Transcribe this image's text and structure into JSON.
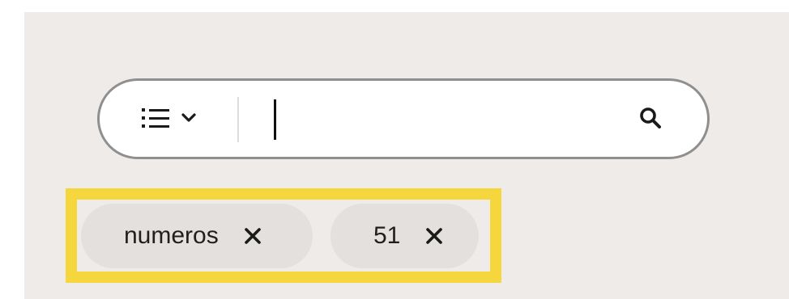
{
  "search": {
    "placeholder": "",
    "value": "",
    "filter_icon": "list-icon",
    "dropdown_icon": "chevron-down-icon",
    "search_icon": "magnifier-icon"
  },
  "filters": [
    {
      "label": "numeros",
      "remove_icon": "close-icon"
    },
    {
      "label": "51",
      "remove_icon": "close-icon"
    }
  ],
  "colors": {
    "panel_background": "#efebe8",
    "search_border": "#8f8f8f",
    "chip_background": "#e4e0dd",
    "highlight": "#f5d63d"
  }
}
